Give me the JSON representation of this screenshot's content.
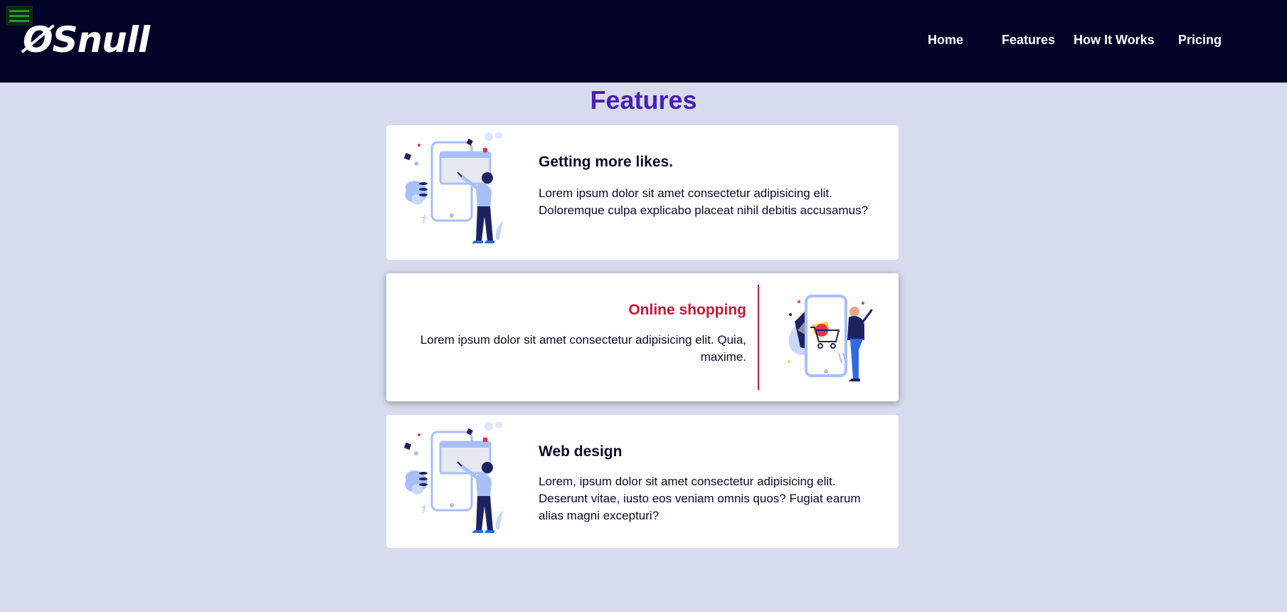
{
  "header": {
    "logo": "ØSnull",
    "nav": [
      "Home",
      "Features",
      "How It Works",
      "Pricing"
    ]
  },
  "main": {
    "title": "Features",
    "cards": [
      {
        "title": "Getting more likes.",
        "text": "Lorem ipsum dolor sit amet consectetur adipisicing elit. Doloremque culpa explicabo placeat nihil debitis accusamus?",
        "illustration": "person-with-phone-illustration"
      },
      {
        "title": "Online shopping",
        "text": "Lorem ipsum dolor sit amet consectetur adipisicing elit. Quia, maxime.",
        "illustration": "shopping-cart-phone-illustration"
      },
      {
        "title": "Web design",
        "text": "Lorem, ipsum dolor sit amet consectetur adipisicing elit. Deserunt vitae, iusto eos veniam omnis quos? Fugiat earum alias magni excepturi?",
        "illustration": "person-with-phone-illustration"
      }
    ]
  },
  "colors": {
    "navbar": "#020327",
    "page_bg": "#d6dcee",
    "title": "#4b1fb0",
    "accent": "#c8173a",
    "card_bg": "#ffffff",
    "text": "#0a0b2a"
  }
}
